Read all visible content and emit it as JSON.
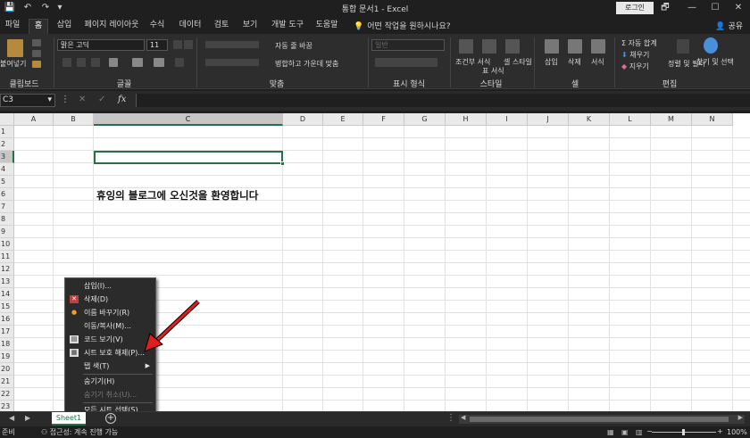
{
  "window": {
    "title": "통합 문서1  -  Excel",
    "login_label": "로그인",
    "controls": [
      "🗗",
      "—",
      "☐",
      "✕"
    ]
  },
  "quick_access": {
    "save": "💾",
    "undo": "↶",
    "redo": "↷",
    "customize": "▾"
  },
  "tabs": [
    "파일",
    "홈",
    "삽입",
    "페이지 레이아웃",
    "수식",
    "데이터",
    "검토",
    "보기",
    "개발 도구",
    "도움말"
  ],
  "active_tab": "홈",
  "tell_me": "어떤 작업을 원하시나요?",
  "share_label": "공유",
  "ribbon": {
    "groups": [
      "클립보드",
      "글꼴",
      "맞춤",
      "표시 형식",
      "스타일",
      "셀",
      "편집"
    ],
    "paste_label": "붙여넣기",
    "font_name": "맑은 고딕",
    "font_size": "11",
    "wrap_text": "자동 줄 바꿈",
    "merge_center": "병합하고 가운데 맞춤",
    "number_format": "일반",
    "style_items": [
      "조건부 서식",
      "표 서식",
      "셀 스타일"
    ],
    "cell_items": [
      "삽입",
      "삭제",
      "서식"
    ],
    "editing_items": [
      "자동 합계",
      "채우기",
      "지우기",
      "정렬 및 필터",
      "찾기 및 선택"
    ]
  },
  "formula_bar": {
    "name_box": "C3",
    "fx": "fx",
    "cancel": "✕",
    "enter": "✓"
  },
  "columns": [
    "A",
    "B",
    "C",
    "D",
    "E",
    "F",
    "G",
    "H",
    "I",
    "J",
    "K",
    "L",
    "M",
    "N"
  ],
  "selected_column": "C",
  "rows": [
    "1",
    "2",
    "3",
    "4",
    "5",
    "6",
    "7",
    "8",
    "9",
    "10",
    "11",
    "12",
    "13",
    "14",
    "15",
    "16",
    "17",
    "18",
    "19",
    "20",
    "21",
    "22",
    "23"
  ],
  "selected_row": "3",
  "cells": {
    "C6": "휴잉의 블로그에 오신것을 환영합니다"
  },
  "context_menu": [
    {
      "label": "삽입(I)...",
      "icon": "",
      "disabled": false
    },
    {
      "label": "삭제(D)",
      "icon": "delete-sheet-icon",
      "disabled": false
    },
    {
      "label": "이름 바꾸기(R)",
      "icon": "rename-icon",
      "disabled": false
    },
    {
      "label": "이동/복사(M)...",
      "icon": "",
      "disabled": false
    },
    {
      "label": "코드 보기(V)",
      "icon": "view-code-icon",
      "disabled": false
    },
    {
      "label": "시트 보호 해제(P)...",
      "icon": "unprotect-sheet-icon",
      "disabled": false
    },
    {
      "label": "탭 색(T)",
      "icon": "",
      "disabled": false,
      "submenu": true
    },
    {
      "label": "숨기기(H)",
      "icon": "",
      "disabled": false
    },
    {
      "label": "숨기기 취소(U)...",
      "icon": "",
      "disabled": true
    },
    {
      "label": "모든 시트 선택(S)",
      "icon": "",
      "disabled": false
    }
  ],
  "sheets": [
    "Sheet1"
  ],
  "status": {
    "mode": "준비",
    "accessibility": "접근성: 계속 진행 가능",
    "zoom": "100%"
  },
  "colors": {
    "accent": "#217346",
    "annotation_arrow": "#e01e1e"
  }
}
